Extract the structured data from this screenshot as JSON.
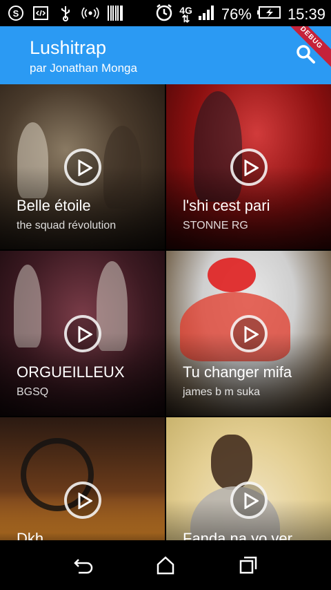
{
  "status_bar": {
    "battery_percent": "76%",
    "time": "15:39",
    "network": "4G",
    "icons": [
      "skype-icon",
      "code-icon",
      "usb-icon",
      "hotspot-icon",
      "barcode-icon",
      "alarm-icon",
      "network-icon",
      "signal-icon",
      "battery-icon"
    ]
  },
  "app_bar": {
    "title": "Lushitrap",
    "subtitle": "par Jonathan Monga",
    "debug_label": "DEBUG",
    "color": "#2b9af3"
  },
  "songs": [
    {
      "title": "Belle étoile",
      "artist": "the squad révolution"
    },
    {
      "title": "l'shi cest pari",
      "artist": "STONNE RG"
    },
    {
      "title": "ORGUEILLEUX",
      "artist": "BGSQ"
    },
    {
      "title": "Tu changer mifa",
      "artist": "james b m suka"
    },
    {
      "title": "Dkh",
      "artist": ""
    },
    {
      "title": "Fanda na yo ver",
      "artist": ""
    }
  ],
  "nav_bar": {
    "icons": [
      "back-icon",
      "home-icon",
      "recents-icon"
    ]
  }
}
